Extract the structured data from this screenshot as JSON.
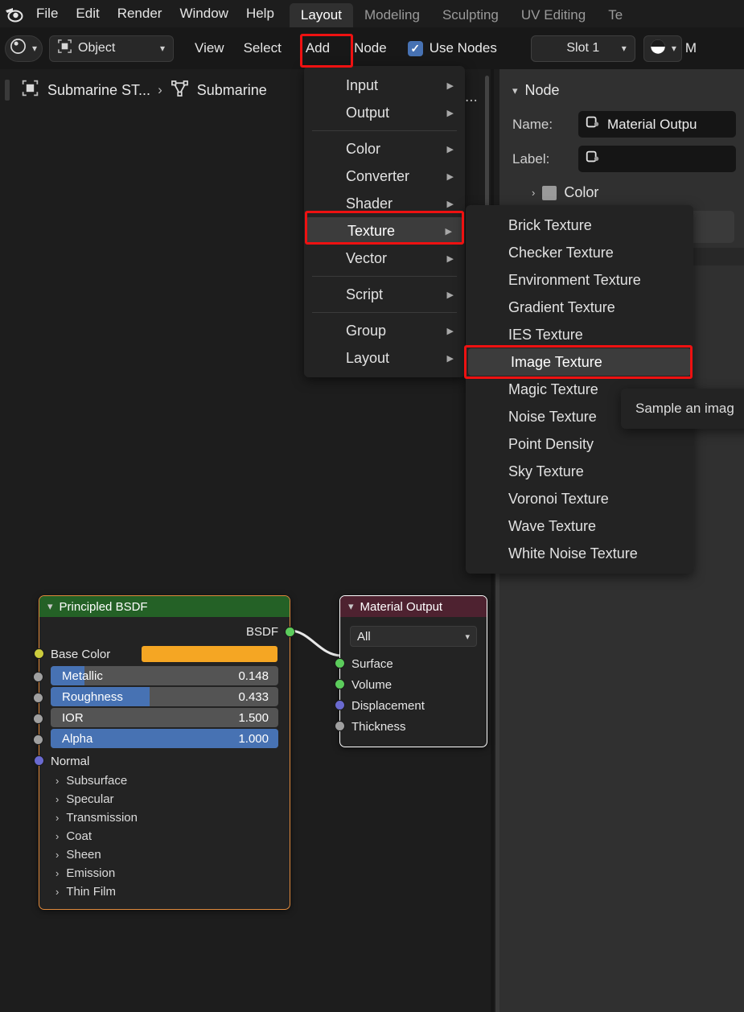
{
  "app": {
    "logo_icon": "blender-logo-icon"
  },
  "menubar": {
    "items": [
      "File",
      "Edit",
      "Render",
      "Window",
      "Help"
    ]
  },
  "workspace_tabs": [
    {
      "label": "Layout",
      "active": true
    },
    {
      "label": "Modeling",
      "active": false
    },
    {
      "label": "Sculpting",
      "active": false
    },
    {
      "label": "UV Editing",
      "active": false
    },
    {
      "label": "Te",
      "active": false
    }
  ],
  "header": {
    "editor_type_icon": "shader-editor-icon",
    "mode_icon": "object-mode-icon",
    "mode_label": "Object",
    "menus": [
      "View",
      "Select",
      "Add",
      "Node"
    ],
    "use_nodes_label": "Use Nodes",
    "use_nodes_checked": true,
    "slot_label": "Slot 1",
    "material_icon": "material-sphere-icon",
    "material_label": "M"
  },
  "breadcrumb": {
    "object_icon": "object-data-icon",
    "object_name": "Submarine ST...",
    "separator": "›",
    "material_icon": "material-node-icon",
    "material_name": "Submarine",
    "overflow": "..."
  },
  "add_menu": {
    "items": [
      {
        "label": "Input",
        "has_submenu": true,
        "selected": false
      },
      {
        "label": "Output",
        "has_submenu": true,
        "selected": false
      },
      {
        "separator": true
      },
      {
        "label": "Color",
        "has_submenu": true,
        "selected": false
      },
      {
        "label": "Converter",
        "has_submenu": true,
        "selected": false
      },
      {
        "label": "Shader",
        "has_submenu": true,
        "selected": false
      },
      {
        "label": "Texture",
        "has_submenu": true,
        "selected": true
      },
      {
        "label": "Vector",
        "has_submenu": true,
        "selected": false
      },
      {
        "separator": true
      },
      {
        "label": "Script",
        "has_submenu": true,
        "selected": false
      },
      {
        "separator": true
      },
      {
        "label": "Group",
        "has_submenu": true,
        "selected": false
      },
      {
        "label": "Layout",
        "has_submenu": true,
        "selected": false
      }
    ],
    "arrow_glyph": "▶"
  },
  "texture_submenu": {
    "items": [
      {
        "label": "Brick Texture",
        "selected": false
      },
      {
        "label": "Checker Texture",
        "selected": false
      },
      {
        "label": "Environment Texture",
        "selected": false
      },
      {
        "label": "Gradient Texture",
        "selected": false
      },
      {
        "label": "IES Texture",
        "selected": false
      },
      {
        "label": "Image Texture",
        "selected": true
      },
      {
        "label": "Magic Texture",
        "selected": false
      },
      {
        "label": "Noise Texture",
        "selected": false
      },
      {
        "label": "Point Density",
        "selected": false
      },
      {
        "label": "Sky Texture",
        "selected": false
      },
      {
        "label": "Voronoi Texture",
        "selected": false
      },
      {
        "label": "Wave Texture",
        "selected": false
      },
      {
        "label": "White Noise Texture",
        "selected": false
      }
    ]
  },
  "tooltip": {
    "text": "Sample an imag"
  },
  "properties_panel": {
    "section_title": "Node",
    "name_label": "Name:",
    "name_value": "Material Outpu",
    "label_label": "Label:",
    "label_value": "",
    "color_label": "Color",
    "node_icon": "node-icon"
  },
  "nodes": [
    {
      "id": "principled-bsdf",
      "title": "Principled BSDF",
      "header_color": "#246126",
      "outputs": [
        {
          "name": "BSDF",
          "socket": "green"
        }
      ],
      "base_color_label": "Base Color",
      "base_color_value": "#f5a623",
      "sliders": [
        {
          "name": "Metallic",
          "value": "0.148",
          "fill_pct": 14.8
        },
        {
          "name": "Roughness",
          "value": "0.433",
          "fill_pct": 43.3
        },
        {
          "name": "IOR",
          "value": "1.500",
          "fill_pct": 0
        },
        {
          "name": "Alpha",
          "value": "1.000",
          "fill_pct": 100
        }
      ],
      "normal_label": "Normal",
      "panels": [
        "Subsurface",
        "Specular",
        "Transmission",
        "Coat",
        "Sheen",
        "Emission",
        "Thin Film"
      ]
    },
    {
      "id": "material-output",
      "title": "Material Output",
      "header_color": "#4e2230",
      "target_value": "All",
      "inputs": [
        {
          "name": "Surface",
          "socket": "green"
        },
        {
          "name": "Volume",
          "socket": "green"
        },
        {
          "name": "Displacement",
          "socket": "purple"
        },
        {
          "name": "Thickness",
          "socket": "grey"
        }
      ]
    }
  ],
  "annotations": {
    "highlight_color": "#ee1111",
    "highlighted": [
      "Add",
      "Texture",
      "Image Texture"
    ]
  }
}
